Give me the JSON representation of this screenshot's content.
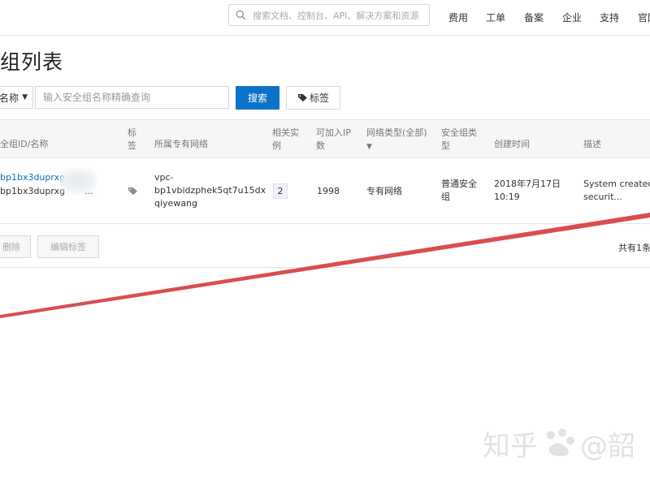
{
  "header": {
    "search_placeholder": "搜索文档、控制台、API、解决方案和资源",
    "nav": [
      "费用",
      "工单",
      "备案",
      "企业",
      "支持",
      "官网"
    ]
  },
  "page": {
    "title": "组列表"
  },
  "filter": {
    "select_value": "名称",
    "input_placeholder": "输入安全组名称精确查询",
    "search_label": "搜索",
    "tag_label": "标签"
  },
  "table": {
    "columns": {
      "id_name": "全组ID/名称",
      "tag_line1": "标",
      "tag_line2": "签",
      "vpc": "所属专有网络",
      "related_line1": "相关实",
      "related_line2": "例",
      "ip_line1": "可加入IP",
      "ip_line2": "数",
      "net_type": "网络类型(全部)",
      "sg_type_line1": "安全组类",
      "sg_type_line2": "型",
      "created": "创建时间",
      "desc": "描述"
    },
    "row": {
      "id_line1": "bp1bx3duprxg",
      "id_line2": "bp1bx3duprxg",
      "id_suffix": "...",
      "vpc_line1": "vpc-",
      "vpc_line2": "bp1vbidzphek5qt7u15dx",
      "vpc_line3": "qiyewang",
      "related_count": "2",
      "ip_count": "1998",
      "net_type": "专有网络",
      "sg_type_line1": "普通安全",
      "sg_type_line2": "组",
      "created_line1": "2018年7月17日",
      "created_line2": "10:19",
      "desc_line1": "System created",
      "desc_line2": "securit..."
    }
  },
  "footer": {
    "delete_label": "删除",
    "edit_tags_label": "编辑标签",
    "total_text": "共有1条"
  },
  "watermark": {
    "text_left": "知乎",
    "text_right": "@韶"
  },
  "colors": {
    "primary": "#0a73c9",
    "link": "#0a6fc2",
    "annotation_line": "#d63a3a"
  }
}
